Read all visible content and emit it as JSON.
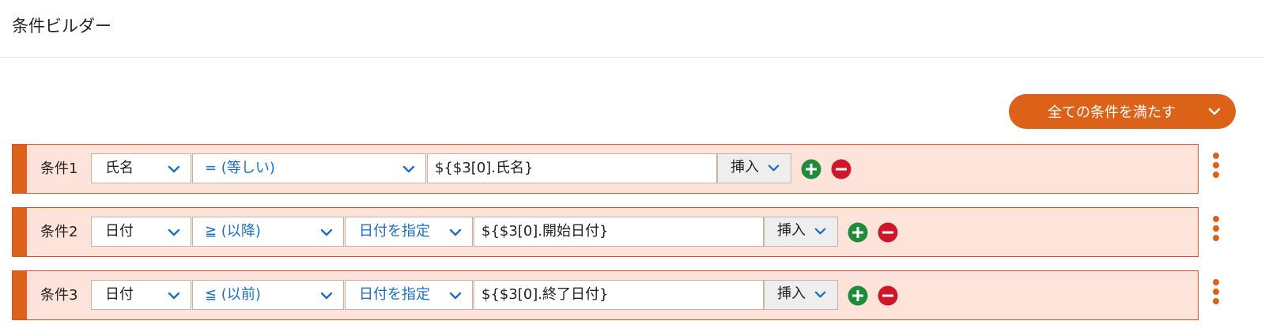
{
  "page": {
    "title": "条件ビルダー"
  },
  "mode_button": {
    "label": "全ての条件を満たす",
    "icon": "chevron-down-icon"
  },
  "colors": {
    "accent": "#dd6219",
    "row_background": "#fde3da",
    "add": "#1e8c3a",
    "remove": "#d0162a",
    "select_text": "#1a6fc9"
  },
  "conditions": [
    {
      "label": "条件1",
      "field": "氏名",
      "operator": "= (等しい)",
      "value": "${$3[0].氏名}",
      "insert_label": "挿入"
    },
    {
      "label": "条件2",
      "field": "日付",
      "operator": "≧ (以降)",
      "date_mode": "日付を指定",
      "value": "${$3[0].開始日付}",
      "insert_label": "挿入"
    },
    {
      "label": "条件3",
      "field": "日付",
      "operator": "≦ (以前)",
      "date_mode": "日付を指定",
      "value": "${$3[0].終了日付}",
      "insert_label": "挿入"
    }
  ],
  "icons": {
    "add": "plus-circle-icon",
    "remove": "minus-circle-icon",
    "menu": "vertical-dots-icon"
  }
}
